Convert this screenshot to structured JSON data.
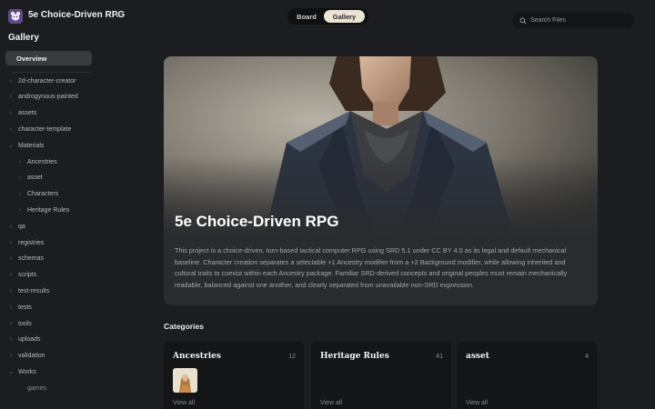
{
  "app": {
    "title": "5e Choice-Driven RPG"
  },
  "view_toggle": {
    "board_label": "Board",
    "gallery_label": "Gallery",
    "active": "Gallery"
  },
  "search": {
    "placeholder": "Search Files"
  },
  "sidebar": {
    "heading": "Gallery",
    "overview_label": "Overview",
    "items": [
      {
        "label": "2d-character-creator",
        "indent": 0,
        "expanded": false
      },
      {
        "label": "androgynous-painted",
        "indent": 0,
        "expanded": false
      },
      {
        "label": "assets",
        "indent": 0,
        "expanded": false
      },
      {
        "label": "character-template",
        "indent": 0,
        "expanded": false
      },
      {
        "label": "Materials",
        "indent": 0,
        "expanded": true
      },
      {
        "label": "Ancestries",
        "indent": 1,
        "expanded": false
      },
      {
        "label": "asset",
        "indent": 1,
        "expanded": false
      },
      {
        "label": "Characters",
        "indent": 1,
        "expanded": false
      },
      {
        "label": "Heritage Rules",
        "indent": 1,
        "expanded": false
      },
      {
        "label": "qa",
        "indent": 0,
        "expanded": false
      },
      {
        "label": "registries",
        "indent": 0,
        "expanded": false
      },
      {
        "label": "schemas",
        "indent": 0,
        "expanded": false
      },
      {
        "label": "scripts",
        "indent": 0,
        "expanded": false
      },
      {
        "label": "test-results",
        "indent": 0,
        "expanded": false
      },
      {
        "label": "tests",
        "indent": 0,
        "expanded": false
      },
      {
        "label": "tools",
        "indent": 0,
        "expanded": false
      },
      {
        "label": "uploads",
        "indent": 0,
        "expanded": false
      },
      {
        "label": "validation",
        "indent": 0,
        "expanded": false
      },
      {
        "label": "Works",
        "indent": 0,
        "expanded": true
      },
      {
        "label": "games",
        "indent": 1,
        "expanded": false,
        "leaf": true
      }
    ]
  },
  "hero": {
    "title": "5e Choice-Driven RPG",
    "description": "This project is a choice-driven, turn-based tactical computer RPG using SRD 5.1 under CC BY 4.0 as its legal and default mechanical baseline. Character creation separates a selectable +1 Ancestry modifier from a +2 Background modifier, while allowing inherited and cultural traits to coexist within each Ancestry package. Familiar SRD-derived concepts and original peoples must remain mechanically readable, balanced against one another, and clearly separated from unavailable non-SRD expression."
  },
  "categories": {
    "heading": "Categories",
    "items": [
      {
        "name": "Ancestries",
        "count": "12",
        "view_all": "View all",
        "has_thumb": true
      },
      {
        "name": "Heritage Rules",
        "count": "41",
        "view_all": "View all",
        "has_thumb": false
      },
      {
        "name": "asset",
        "count": "4",
        "view_all": "View all",
        "has_thumb": false
      }
    ]
  },
  "colors": {
    "background": "#1c1d20",
    "toggle_active": "#ebe3d3",
    "logo": "#5e4d8c",
    "card": "#141517"
  }
}
